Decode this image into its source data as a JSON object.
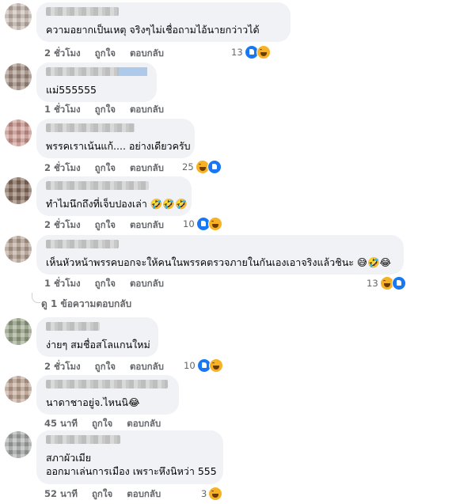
{
  "actions": {
    "like": "ถูกใจ",
    "reply": "ตอบกลับ"
  },
  "colors": {
    "bubble": "#f0f2f5",
    "meta": "#65676b",
    "like": "#1877f2",
    "haha": "#f7b125"
  },
  "comments": [
    {
      "text": [
        "ความอยากเป็นเหตุ จริงๆไม่เชื่อถามไอ้นายกว่าวได้"
      ],
      "time": "2 ชั่วโมง",
      "reactions": {
        "count": "13",
        "icons": [
          "like-icon",
          "haha-icon"
        ]
      }
    },
    {
      "text": [
        "แม่555555"
      ],
      "time": "1 ชั่วโมง",
      "reactions": null
    },
    {
      "text": [
        "พรรคเราเน้นแก้.... อย่างเดียวครับ"
      ],
      "time": "2 ชั่วโมง",
      "reactions": {
        "count": "25",
        "icons": [
          "haha-icon",
          "like-icon"
        ]
      }
    },
    {
      "text": [
        "ทำไมนึกถึงที่เจ็บปองเล่า 🤣🤣🤣"
      ],
      "time": "2 ชั่วโมง",
      "reactions": {
        "count": "10",
        "icons": [
          "like-icon",
          "haha-icon"
        ]
      }
    },
    {
      "text": [
        "เห็นหัวหน้าพรรคบอกจะให้คนในพรรคตรวจภายในกันเองเอาจริงแล้วชินะ 😅🤣😂"
      ],
      "time": "1 ชั่วโมง",
      "reactions": {
        "count": "13",
        "icons": [
          "haha-icon",
          "like-icon"
        ]
      },
      "view_replies": "ดู 1 ข้อความตอบกลับ"
    },
    {
      "text": [
        "ง่ายๆ สมชื่อสโลแกนใหม่"
      ],
      "time": "2 ชั่วโมง",
      "reactions": {
        "count": "10",
        "icons": [
          "like-icon",
          "haha-icon"
        ]
      }
    },
    {
      "text": [
        "นาดาชาอยู่จ.ไหนนิ😂"
      ],
      "time": "45 นาที",
      "reactions": null
    },
    {
      "text": [
        "สภาผัวเมีย",
        "ออกมาเล่นการเมือง เพราะหึงนิหว่า 555"
      ],
      "time": "52 นาที",
      "reactions": {
        "count": "3",
        "icons": [
          "haha-icon"
        ]
      }
    }
  ]
}
